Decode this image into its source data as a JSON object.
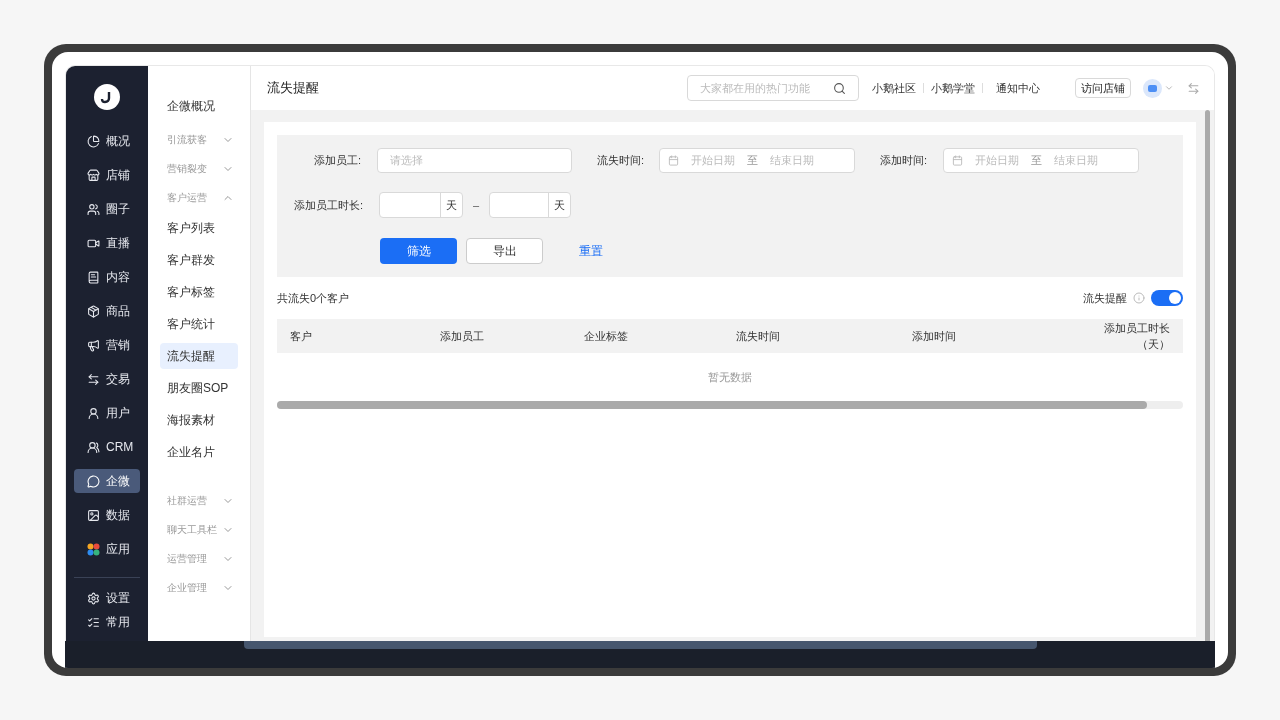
{
  "nav": {
    "items": [
      {
        "label": "概况",
        "selected": false
      },
      {
        "label": "店铺",
        "selected": false
      },
      {
        "label": "圈子",
        "selected": false
      },
      {
        "label": "直播",
        "selected": false
      },
      {
        "label": "内容",
        "selected": false
      },
      {
        "label": "商品",
        "selected": false
      },
      {
        "label": "营销",
        "selected": false
      },
      {
        "label": "交易",
        "selected": false
      },
      {
        "label": "用户",
        "selected": false
      },
      {
        "label": "CRM",
        "selected": false
      },
      {
        "label": "企微",
        "selected": true
      },
      {
        "label": "数据",
        "selected": false
      },
      {
        "label": "应用",
        "selected": false
      }
    ],
    "bottom": [
      "设置",
      "常用"
    ]
  },
  "submenu": [
    {
      "kind": "link",
      "label": "企微概况",
      "selected": false
    },
    {
      "kind": "group",
      "label": "引流获客",
      "expanded": false
    },
    {
      "kind": "group",
      "label": "营销裂变",
      "expanded": false
    },
    {
      "kind": "group",
      "label": "客户运营",
      "expanded": true
    },
    {
      "kind": "link",
      "label": "客户列表",
      "selected": false
    },
    {
      "kind": "link",
      "label": "客户群发",
      "selected": false
    },
    {
      "kind": "link",
      "label": "客户标签",
      "selected": false
    },
    {
      "kind": "link",
      "label": "客户统计",
      "selected": false
    },
    {
      "kind": "link",
      "label": "流失提醒",
      "selected": true
    },
    {
      "kind": "link",
      "label": "朋友圈SOP",
      "selected": false
    },
    {
      "kind": "link",
      "label": "海报素材",
      "selected": false
    },
    {
      "kind": "link",
      "label": "企业名片",
      "selected": false
    },
    {
      "kind": "group",
      "label": "社群运营",
      "expanded": false
    },
    {
      "kind": "group",
      "label": "聊天工具栏",
      "expanded": false
    },
    {
      "kind": "group",
      "label": "运营管理",
      "expanded": false
    },
    {
      "kind": "group",
      "label": "企业管理",
      "expanded": false
    }
  ],
  "header": {
    "title": "流失提醒",
    "search": {
      "placeholder": "大家都在用的热门功能"
    },
    "links": [
      "小鹅社区",
      "小鹅学堂",
      "通知中心"
    ],
    "visit_button": "访问店铺"
  },
  "filters": {
    "staff": {
      "label": "添加员工:",
      "placeholder": "请选择"
    },
    "lost_time": {
      "label": "流失时间:",
      "start": "开始日期",
      "sep": "至",
      "end": "结束日期"
    },
    "add_time": {
      "label": "添加时间:",
      "start": "开始日期",
      "sep": "至",
      "end": "结束日期"
    },
    "duration": {
      "label": "添加员工时长:",
      "unit1": "天",
      "dash": "–",
      "unit2": "天"
    },
    "buttons": {
      "filter": "筛选",
      "export": "导出",
      "reset": "重置"
    }
  },
  "summary": "共流失0个客户",
  "alert_toggle": {
    "label": "流失提醒",
    "on": true
  },
  "table": {
    "columns": [
      "客户",
      "添加员工",
      "企业标签",
      "流失时间",
      "添加时间",
      "添加员工时长（天）"
    ],
    "empty": "暂无数据"
  }
}
